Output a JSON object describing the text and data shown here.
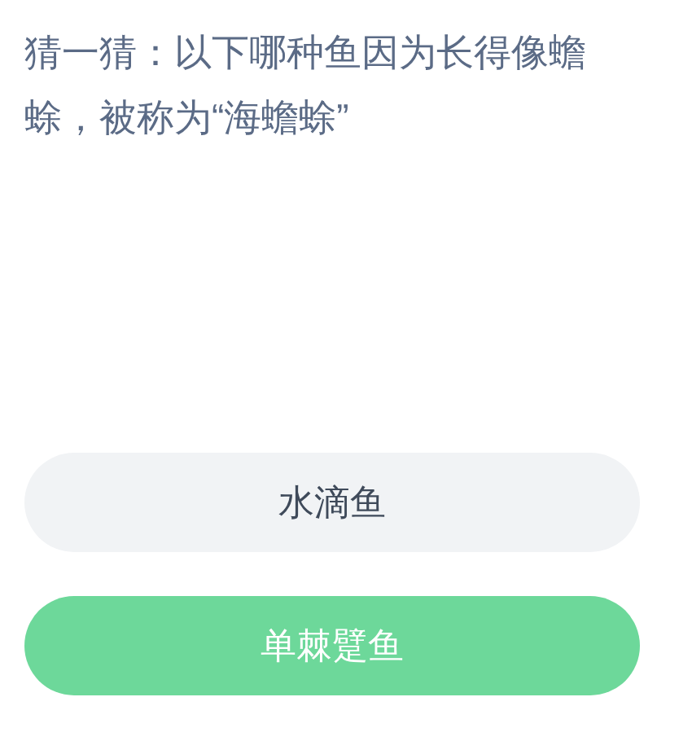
{
  "question": "猜一猜：以下哪种鱼因为长得像蟾蜍，被称为“海蟾蜍”",
  "options": [
    {
      "label": "水滴鱼",
      "selected": false
    },
    {
      "label": "单棘躄鱼",
      "selected": true
    }
  ]
}
